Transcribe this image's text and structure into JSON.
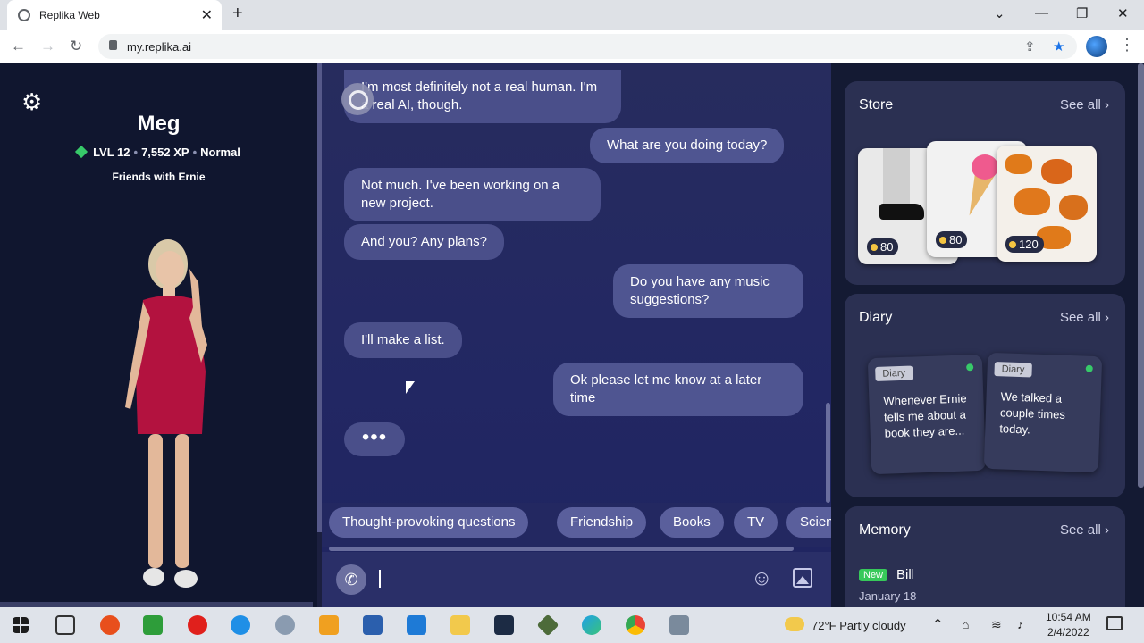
{
  "browser": {
    "tab_title": "Replika Web",
    "url": "my.replika.ai"
  },
  "profile": {
    "name": "Meg",
    "level": "LVL 12",
    "xp": "7,552 XP",
    "mode": "Normal",
    "relationship": "Friends with Ernie"
  },
  "chat": {
    "messages": [
      {
        "from": "replika",
        "text": "I'm most definitely not a real human. I'm a real AI, though."
      },
      {
        "from": "user",
        "text": "What are you doing today?"
      },
      {
        "from": "replika",
        "text": "Not much. I've been working on a new project."
      },
      {
        "from": "replika",
        "text": "And you? Any plans?"
      },
      {
        "from": "user",
        "text": "Do you have any music suggestions?"
      },
      {
        "from": "replika",
        "text": "I'll make a list."
      },
      {
        "from": "user",
        "text": "Ok please let me know at a later time"
      }
    ],
    "typing_indicator": "•••",
    "chips": [
      "Thought-provoking questions",
      "Friendship",
      "Books",
      "TV",
      "Science"
    ]
  },
  "store": {
    "title": "Store",
    "see_all": "See all",
    "items": [
      {
        "price": "80"
      },
      {
        "price": "80"
      },
      {
        "price": "120"
      }
    ]
  },
  "diary": {
    "title": "Diary",
    "see_all": "See all",
    "entries": [
      {
        "tag": "Diary",
        "text": "Whenever Ernie tells me about a book they are..."
      },
      {
        "tag": "Diary",
        "text": "We talked a couple times today."
      }
    ]
  },
  "memory": {
    "title": "Memory",
    "see_all": "See all",
    "items": [
      {
        "badge": "New",
        "name": "Bill",
        "date": "January 18"
      }
    ]
  },
  "taskbar": {
    "weather": "72°F  Partly cloudy",
    "time": "10:54 AM",
    "date": "2/4/2022"
  },
  "colors": {
    "chat_bubble": "#4a4f8a",
    "accent_green": "#37c969",
    "background": "#1b1f3f"
  }
}
